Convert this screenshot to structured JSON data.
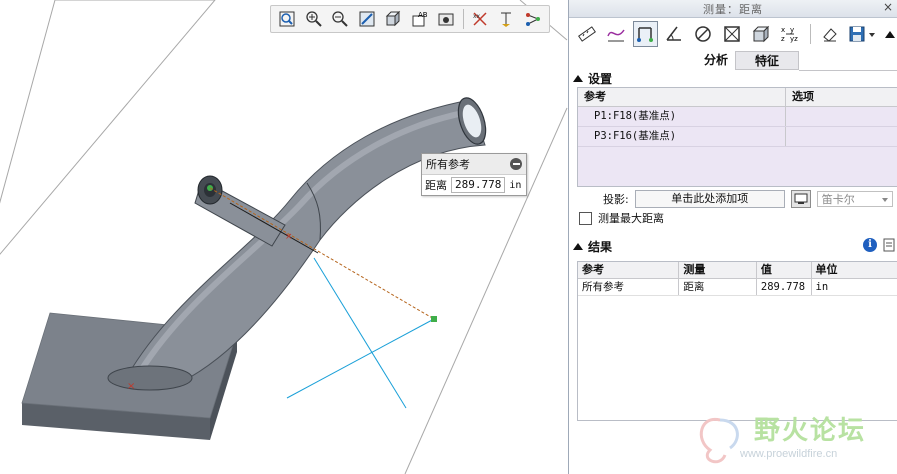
{
  "viewport": {
    "toolbar_icons": [
      "zoom-fit-icon",
      "zoom-in-icon",
      "zoom-out-icon",
      "repaint-icon",
      "display-style-icon",
      "saved-views-icon",
      "view-manager-icon",
      "datum-display-icon",
      "spin-center-icon",
      "annotation-display-icon"
    ],
    "popup": {
      "title": "所有参考",
      "label": "距离",
      "value": "289.778",
      "unit": "in"
    }
  },
  "dialog": {
    "title": "测量：距离",
    "close": "×",
    "tools": [
      "length-tool-icon",
      "distance-tool-icon",
      "angle-tool-icon",
      "diameter-tool-icon",
      "area-tool-icon",
      "volume-tool-icon",
      "transform-tool-icon",
      "clear-tool-icon",
      "save-tool-icon"
    ],
    "tabs": [
      "分析",
      "特征"
    ],
    "settings": {
      "heading": "设置",
      "columns": [
        "参考",
        "选项"
      ],
      "refs": [
        "P1:F18(基准点)",
        "P3:F16(基准点)"
      ],
      "projection_label": "投影:",
      "projection_value": "单击此处添加项",
      "coord_system": "笛卡尔",
      "max_distance_label": "测量最大距离",
      "max_distance_checked": false
    },
    "results": {
      "heading": "结果",
      "columns": [
        "参考",
        "测量",
        "值",
        "单位"
      ],
      "rows": [
        {
          "ref": "所有参考",
          "measure": "距离",
          "value": "289.778",
          "unit": "in"
        }
      ]
    }
  },
  "watermark": {
    "name": "野火论坛",
    "url": "www.proewildfire.cn"
  },
  "colors": {
    "pipe": "#8a9099",
    "base_top": "#7c828b",
    "base_side": "#5a6068",
    "measure_line": "#b5651d",
    "cyan_axes": "#1aa0d8",
    "ref_table_bg": "#ece6f4"
  }
}
